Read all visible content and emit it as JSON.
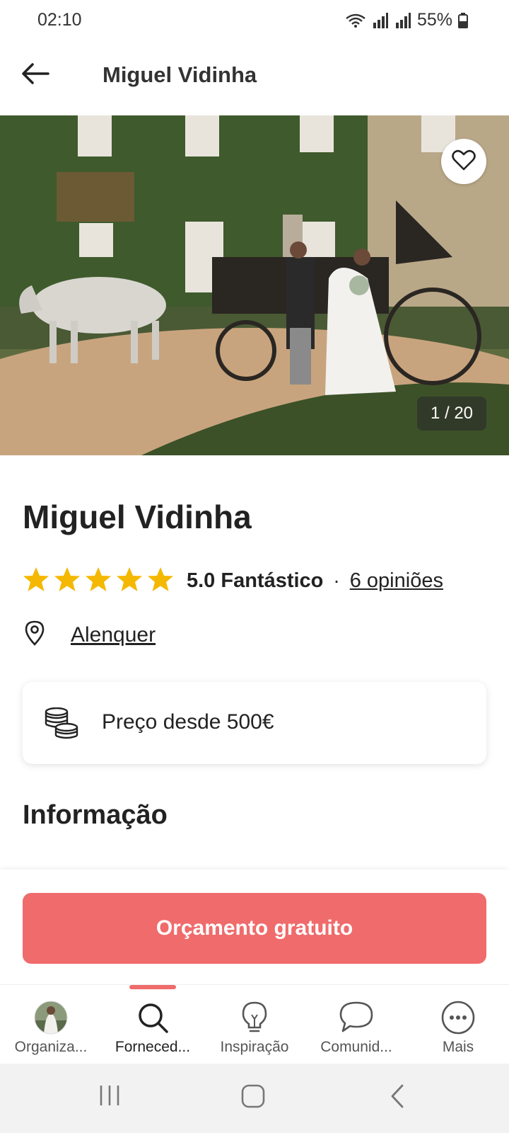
{
  "status_bar": {
    "time": "02:10",
    "battery": "55%"
  },
  "header": {
    "title": "Miguel Vidinha",
    "back_icon": "arrow-left-icon"
  },
  "gallery": {
    "counter": "1 / 20",
    "favorite_icon": "heart-outline-icon"
  },
  "vendor": {
    "name": "Miguel Vidinha",
    "rating_value": 5,
    "rating_text": "5.0 Fantástico",
    "separator": "·",
    "reviews_link": "6 opiniões",
    "location": "Alenquer"
  },
  "price": {
    "text": "Preço desde 500€",
    "icon": "coins-icon"
  },
  "section": {
    "title": "Informação"
  },
  "cta": {
    "label": "Orçamento gratuito"
  },
  "bottom_nav": [
    {
      "label": "Organiza...",
      "icon": "avatar-photo"
    },
    {
      "label": "Forneced...",
      "icon": "search-icon",
      "active": true
    },
    {
      "label": "Inspiração",
      "icon": "lightbulb-icon"
    },
    {
      "label": "Comunid...",
      "icon": "chat-bubble-icon"
    },
    {
      "label": "Mais",
      "icon": "more-dots-icon"
    }
  ],
  "colors": {
    "accent": "#f06b6b",
    "star": "#f5b800",
    "text": "#222222"
  }
}
